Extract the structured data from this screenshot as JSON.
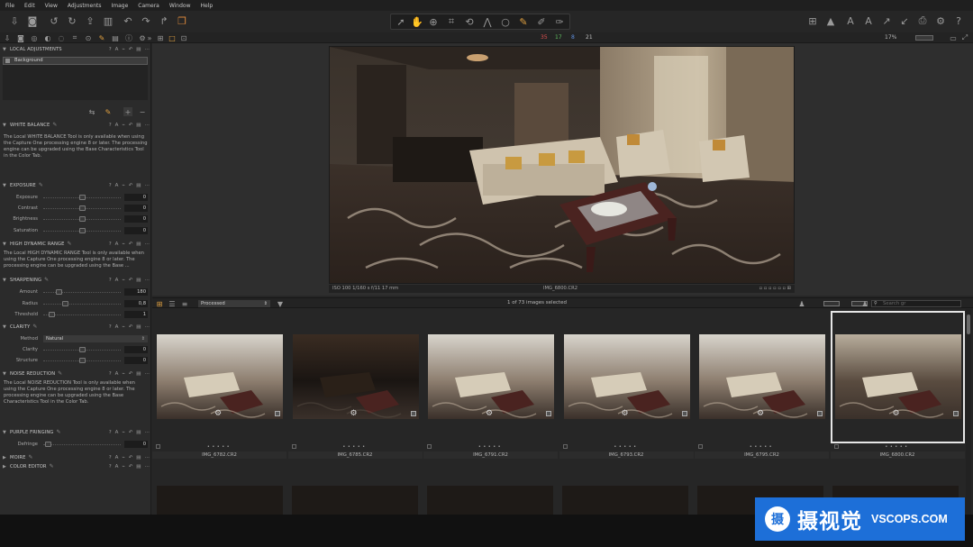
{
  "menu": [
    "File",
    "Edit",
    "View",
    "Adjustments",
    "Image",
    "Camera",
    "Window",
    "Help"
  ],
  "toolbar": {
    "left_icons": [
      "import-icon",
      "camera-icon",
      "rotate-left-icon",
      "rotate-right-icon",
      "export-icon",
      "trash-icon",
      "undo-icon",
      "redo-icon",
      "copy-adjustments-icon",
      "apply-adjustments-icon"
    ],
    "cursor_tools": [
      "select-cursor-icon",
      "pan-icon",
      "zoom-icon",
      "crop-icon",
      "rotate-icon",
      "keystone-icon",
      "spot-removal-icon",
      "brush-icon",
      "eraser-icon",
      "gradient-icon"
    ],
    "right_icons": [
      "grid-view-icon",
      "warning-icon",
      "text-icon",
      "arrow-icon",
      "check-icon",
      "print-icon",
      "settings-icon",
      "help-icon"
    ]
  },
  "statusbar": {
    "stats": [
      "35",
      "17",
      "8",
      "21"
    ],
    "zoom": "17%"
  },
  "left_panel": {
    "local_adjustments": {
      "title": "LOCAL ADJUSTMENTS",
      "layer": "Background"
    },
    "white_balance": {
      "title": "WHITE BALANCE",
      "note": "The Local WHITE BALANCE Tool is only available when using the Capture One processing engine 8 or later. The processing engine can be upgraded using the Base Characteristics Tool in the Color Tab."
    },
    "exposure": {
      "title": "EXPOSURE",
      "rows": [
        {
          "label": "Exposure",
          "value": "0",
          "pos": 0.5
        },
        {
          "label": "Contrast",
          "value": "0",
          "pos": 0.5
        },
        {
          "label": "Brightness",
          "value": "0",
          "pos": 0.5
        },
        {
          "label": "Saturation",
          "value": "0",
          "pos": 0.5
        }
      ]
    },
    "hdr": {
      "title": "HIGH DYNAMIC RANGE",
      "note": "The Local HIGH DYNAMIC RANGE Tool is only available when using the Capture One processing engine 8 or later. The processing engine can be upgraded using the Base ..."
    },
    "sharpening": {
      "title": "SHARPENING",
      "rows": [
        {
          "label": "Amount",
          "value": "180",
          "pos": 0.18
        },
        {
          "label": "Radius",
          "value": "0,8",
          "pos": 0.26
        },
        {
          "label": "Threshold",
          "value": "1",
          "pos": 0.08
        }
      ]
    },
    "clarity": {
      "title": "CLARITY",
      "method_label": "Method",
      "method_value": "Natural",
      "rows": [
        {
          "label": "Clarity",
          "value": "0",
          "pos": 0.5
        },
        {
          "label": "Structure",
          "value": "0",
          "pos": 0.5
        }
      ]
    },
    "noise_reduction": {
      "title": "NOISE REDUCTION",
      "note": "The Local NOISE REDUCTION Tool is only available when using the Capture One processing engine 8 or later. The processing engine can be upgraded using the Base Characteristics Tool in the Color Tab."
    },
    "purple_fringing": {
      "title": "PURPLE FRINGING",
      "rows": [
        {
          "label": "Defringe",
          "value": "0",
          "pos": 0.02
        }
      ]
    },
    "moire": {
      "title": "MOIRE"
    },
    "color_editor": {
      "title": "COLOR EDITOR"
    }
  },
  "viewer": {
    "info_left": "ISO 100 1/160 s f/11 17 mm",
    "info_center": "IMG_6800.CR2"
  },
  "browser": {
    "filter": "Processed",
    "count": "1 of 73 images selected",
    "search_placeholder": "Search gr",
    "thumbnails": [
      {
        "name": "IMG_6782.CR2",
        "tone": "bright"
      },
      {
        "name": "IMG_6785.CR2",
        "tone": "dark"
      },
      {
        "name": "IMG_6791.CR2",
        "tone": "bright"
      },
      {
        "name": "IMG_6793.CR2",
        "tone": "bright"
      },
      {
        "name": "IMG_6795.CR2",
        "tone": "bright"
      },
      {
        "name": "IMG_6800.CR2",
        "tone": "mid",
        "selected": true
      }
    ]
  },
  "watermark": {
    "logo": "摄",
    "cn": "摄视觉",
    "en": "VSCOPS.COM"
  }
}
